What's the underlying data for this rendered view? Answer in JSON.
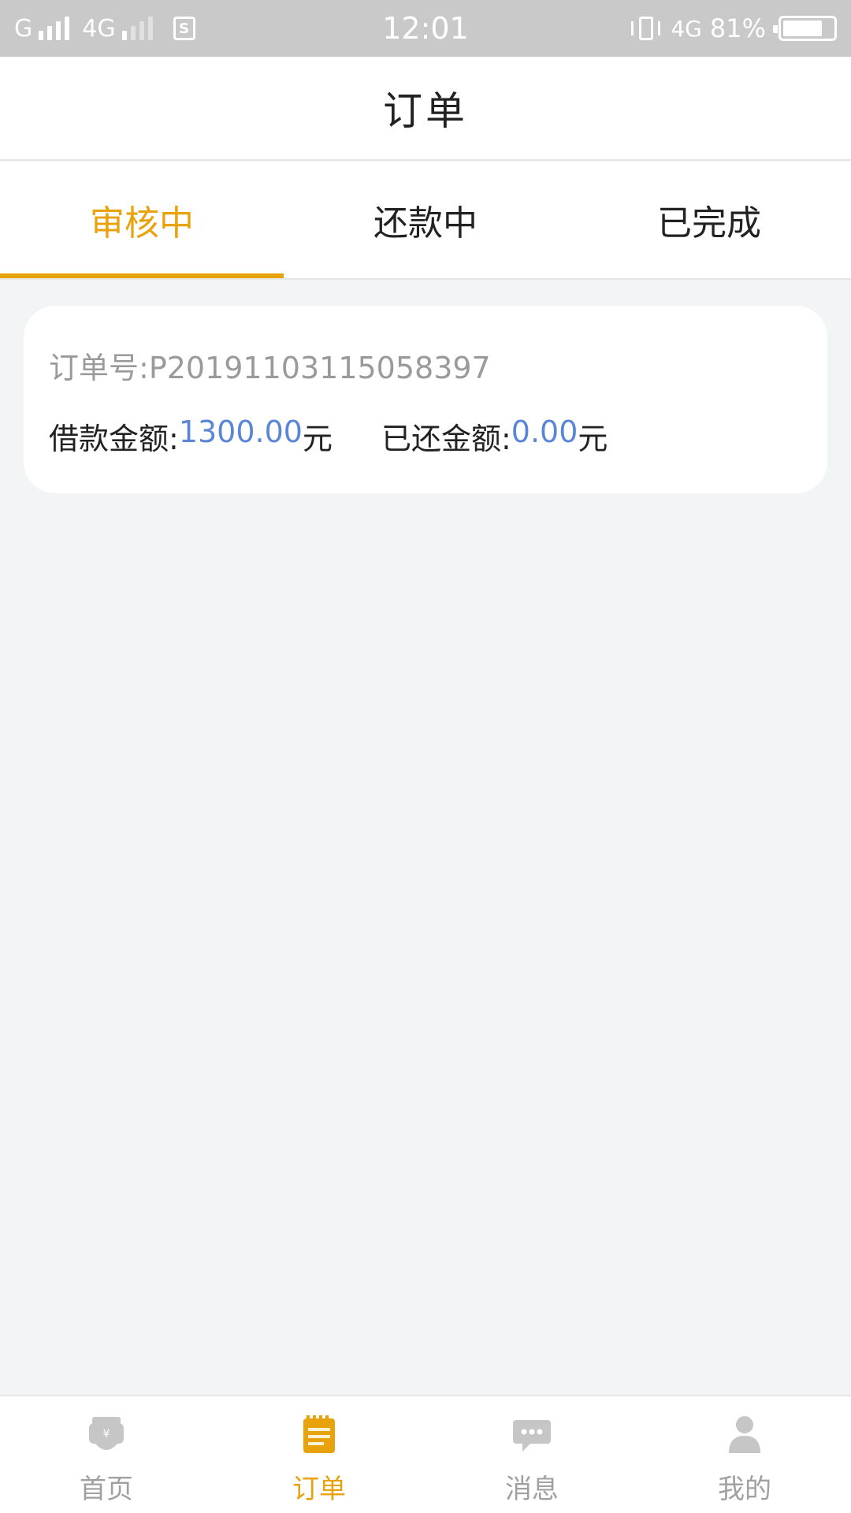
{
  "status_bar": {
    "carrier1": "G",
    "carrier2": "4G",
    "time": "12:01",
    "network": "4G",
    "battery_percent": "81%",
    "battery_level": 0.81
  },
  "header": {
    "title": "订单"
  },
  "tabs": [
    {
      "label": "审核中",
      "active": true
    },
    {
      "label": "还款中",
      "active": false
    },
    {
      "label": "已完成",
      "active": false
    }
  ],
  "order": {
    "order_no_label": "订单号:",
    "order_no": "P20191103115058397",
    "loan_label": "借款金额:",
    "loan_value": "1300.00",
    "loan_unit": "元",
    "repaid_label": "已还金额:",
    "repaid_value": "0.00",
    "repaid_unit": "元"
  },
  "bottom_nav": [
    {
      "label": "首页",
      "icon": "home-wallet-icon",
      "active": false
    },
    {
      "label": "订单",
      "icon": "order-notepad-icon",
      "active": true
    },
    {
      "label": "消息",
      "icon": "message-bubble-icon",
      "active": false
    },
    {
      "label": "我的",
      "icon": "person-icon",
      "active": false
    }
  ],
  "colors": {
    "accent": "#e8a20c",
    "amount_blue": "#5b86d6",
    "background": "#f3f4f6"
  }
}
